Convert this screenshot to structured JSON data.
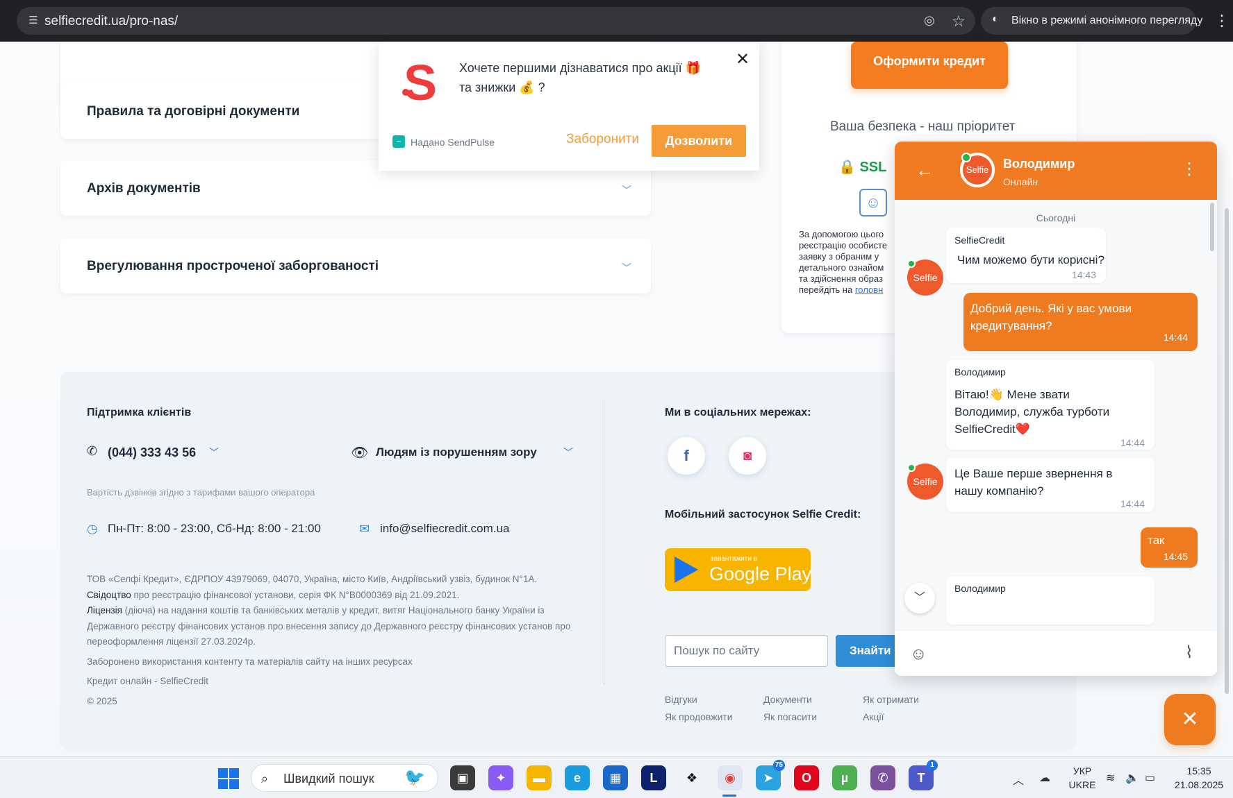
{
  "browser": {
    "url": "selfiecredit.ua/pro-nas/",
    "incognito_label": "Вікно в режимі анонімного перегляду"
  },
  "accordion": [
    {
      "label": "Правила та договірні документи"
    },
    {
      "label": "Архів документів"
    },
    {
      "label": "Врегулювання простроченої заборгованості"
    }
  ],
  "side_card": {
    "cta": "Оформити кредит",
    "safety_title": "Ваша безпека - наш пріоритет",
    "ssl": "SSL",
    "text_lines": [
      "За допомогою цього",
      "реєстрацію особисте",
      "заявку з обраним у",
      "детального ознайом",
      "та здійснення образ",
      "перейдіть на"
    ],
    "link": "головн"
  },
  "push_popup": {
    "message": "Хочете першими дізнаватися про акції 🎁 та знижки 💰 ?",
    "brand": "Надано SendPulse",
    "deny": "Заборонити",
    "allow": "Дозволити"
  },
  "footer": {
    "support_title": "Підтримка клієнтів",
    "phone": "(044) 333 43 56",
    "vision": "Людям із порушенням зору",
    "cost_note": "Вартість дзвінків згідно з тарифами вашого оператора",
    "hours": "Пн-Пт: 8:00 - 23:00, Сб-Нд: 8:00 - 21:00",
    "email": "info@selfiecredit.com.ua",
    "legal_1": "ТОВ «Селфі Кредит», ЄДРПОУ 43979069, 04070, Україна, місто Київ, Андріївський узвіз, будинок N°1А.",
    "legal_2_b": "Свідоцтво",
    "legal_2": " про реєстрацію фінансової установи, серія ФК N°B0000369 від 21.09.2021.",
    "legal_3_b": "Ліцензія",
    "legal_3": " (діюча) на надання коштів та банківських металів у кредит, витяг Національного банку України із Державного реєстру фінансових установ про внесення запису до Державного реєстру фінансових установ про переоформлення ліцензії 27.03.2024р.",
    "legal_4": "Заборонено використання контенту та матеріалів сайту на інших ресурсах",
    "legal_5": "Кредит онлайн - SelfieCredit",
    "copyright": "© 2025",
    "social_title": "Ми в соціальних мережах:",
    "app_title": "Мобільний застосунок Selfie Credit:",
    "gplay_small": "завантажити в",
    "gplay_big": "Google Play",
    "search_placeholder": "Пошук по сайту",
    "search_button": "Знайти",
    "links": [
      "Відгуки",
      "Документи",
      "Як отримати",
      "Як продовжити",
      "Як погасити",
      "Акції"
    ]
  },
  "chat": {
    "agent_name": "Володимир",
    "status": "Онлайн",
    "date": "Сьогодні",
    "avatar_label": "Selfie",
    "messages": [
      {
        "sender": "SelfieCredit",
        "text": "Чим можемо бути корисні?",
        "time": "14:43"
      },
      {
        "text": "Добрий день. Які у вас умови кредитування?",
        "time": "14:44"
      },
      {
        "sender": "Володимир",
        "text": "Вітаю!👋 Мене звати Володимир, служба турботи SelfieCredit❤️",
        "time": "14:44"
      },
      {
        "text": "Це Ваше перше звернення в нашу компанію?",
        "time": "14:44"
      },
      {
        "text": "так",
        "time": "14:45"
      },
      {
        "sender": "Володимир"
      }
    ]
  },
  "taskbar": {
    "search": "Швидкий пошук",
    "lang_1": "УКР",
    "lang_2": "UKRE",
    "time": "15:35",
    "date": "21.08.2025",
    "telegram_badge": "75",
    "teams_badge": "1"
  },
  "colors": {
    "accent_orange": "#f07b22",
    "accent_blue": "#2f8ed9"
  }
}
